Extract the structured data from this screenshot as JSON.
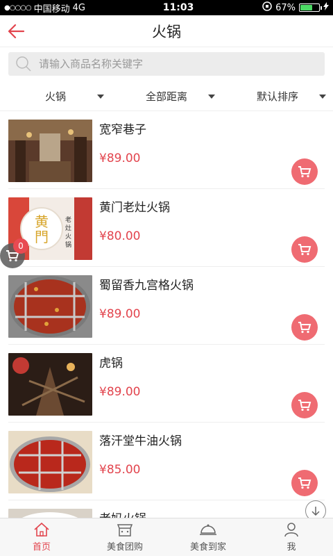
{
  "status_bar": {
    "signal_dots": "●○○○○",
    "carrier": "中国移动",
    "network": "4G",
    "time": "11:03",
    "battery": "67%",
    "battery_level": 0.67
  },
  "header": {
    "title": "火锅",
    "back_icon": "back-arrow-icon"
  },
  "search": {
    "placeholder": "请输入商品名称关键字"
  },
  "filters": [
    {
      "label": "火锅"
    },
    {
      "label": "全部距离"
    },
    {
      "label": "默认排序"
    }
  ],
  "items": [
    {
      "name": "宽窄巷子",
      "price": "¥89.00"
    },
    {
      "name": "黄门老灶火锅",
      "price": "¥80.00"
    },
    {
      "name": "蜀留香九宫格火锅",
      "price": "¥89.00"
    },
    {
      "name": "虎锅",
      "price": "¥89.00"
    },
    {
      "name": "落汗堂牛油火锅",
      "price": "¥85.00"
    },
    {
      "name": "老妈火锅",
      "price": ""
    }
  ],
  "cart_float": {
    "count": "0"
  },
  "tabbar": [
    {
      "label": "首页",
      "icon": "home-icon"
    },
    {
      "label": "美食团购",
      "icon": "shop-icon"
    },
    {
      "label": "美食到家",
      "icon": "delivery-icon"
    },
    {
      "label": "我",
      "icon": "user-icon"
    }
  ],
  "colors": {
    "accent": "#e2444d",
    "cart_button": "#ef6b72"
  }
}
